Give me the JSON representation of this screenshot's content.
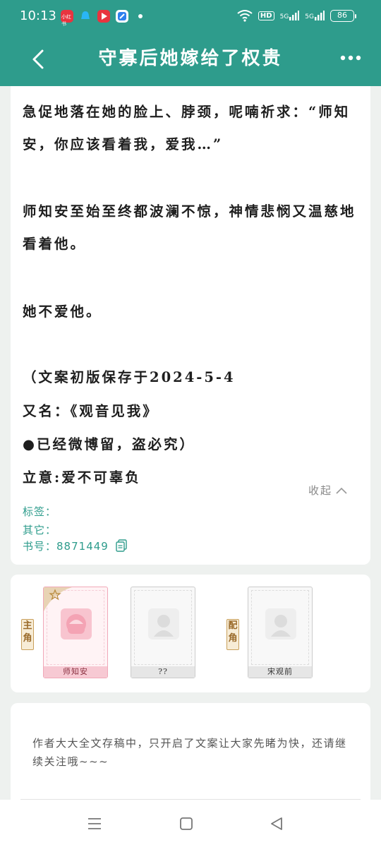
{
  "status": {
    "time": "10:13",
    "app_badge": "小红书",
    "hd": "HD",
    "net1": "5G",
    "net2": "5G",
    "battery": "86"
  },
  "nav": {
    "title": "守寡后她嫁给了权贵"
  },
  "intro": {
    "paragraphs": [
      "急促地落在她的脸上、脖颈，呢喃祈求：“师知",
      "安，你应该看着我，爱我…”",
      "师知安至始至终都波澜不惊，神情悲悯又温慈地",
      "看着他。",
      "她不爱他。",
      "（文案初版保存于2024-5-4",
      "又名：《观音见我》",
      "●已经微博留，盗必究）",
      "立意:爱不可辜负"
    ],
    "fold_label": "收起",
    "tags_label": "标签：",
    "other_label": "其它：",
    "book_no_label": "书号：",
    "book_no": "8871449"
  },
  "characters": {
    "main_role_tag": "主角",
    "support_role_tag": "配角",
    "items": [
      {
        "name": "师知安",
        "avatar": "pink-girl-avatar"
      },
      {
        "name": "??",
        "avatar": "grey-default-avatar"
      },
      {
        "name": "宋观前",
        "avatar": "grey-default-avatar"
      }
    ]
  },
  "author_note": {
    "text": "作者大大全文存稿中，只开启了文案让大家先睹为快，还请继续关注哦~~~"
  },
  "colors": {
    "primary": "#2e9c8c",
    "pink": "#f8c4cf",
    "gold": "#c9a05b"
  }
}
